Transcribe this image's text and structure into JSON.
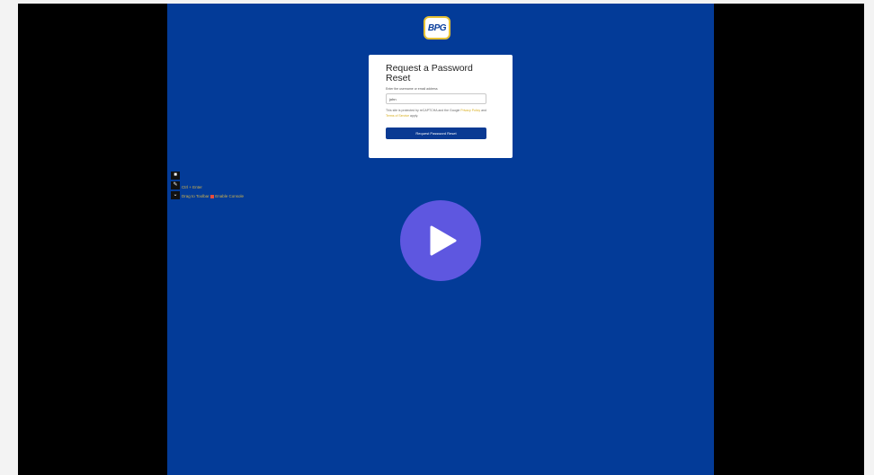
{
  "page": {
    "brand_logo_text": "BPG",
    "colors": {
      "stage_bg": "#033b98",
      "outer_bg": "#000000",
      "page_bg": "#f3f3f3",
      "accent": "#e7c235",
      "button": "#0a3a93",
      "play_button": "#5e57e0"
    }
  },
  "reset_card": {
    "title": "Request a Password Reset",
    "instruction": "Enter the username or email address",
    "input_value": "john",
    "notice_prefix": "This site is protected by reCAPTCHA and the Google",
    "privacy_link": "Privacy Policy",
    "notice_and": "and",
    "terms_link": "Terms of Service",
    "notice_suffix": "apply.",
    "submit_label": "Request Password Reset"
  },
  "toolbar": {
    "icons": [
      "stop-icon",
      "edit-icon",
      "chevron-icon"
    ],
    "icon_glyphs": [
      "■",
      "✎",
      "⌄"
    ]
  },
  "overlay_notes": {
    "note1": "Ctrl + Enter",
    "note2_prefix": "Drag to Toolbar",
    "note2_suffix": "Enable Console"
  },
  "player": {
    "play_icon": "play-icon"
  }
}
